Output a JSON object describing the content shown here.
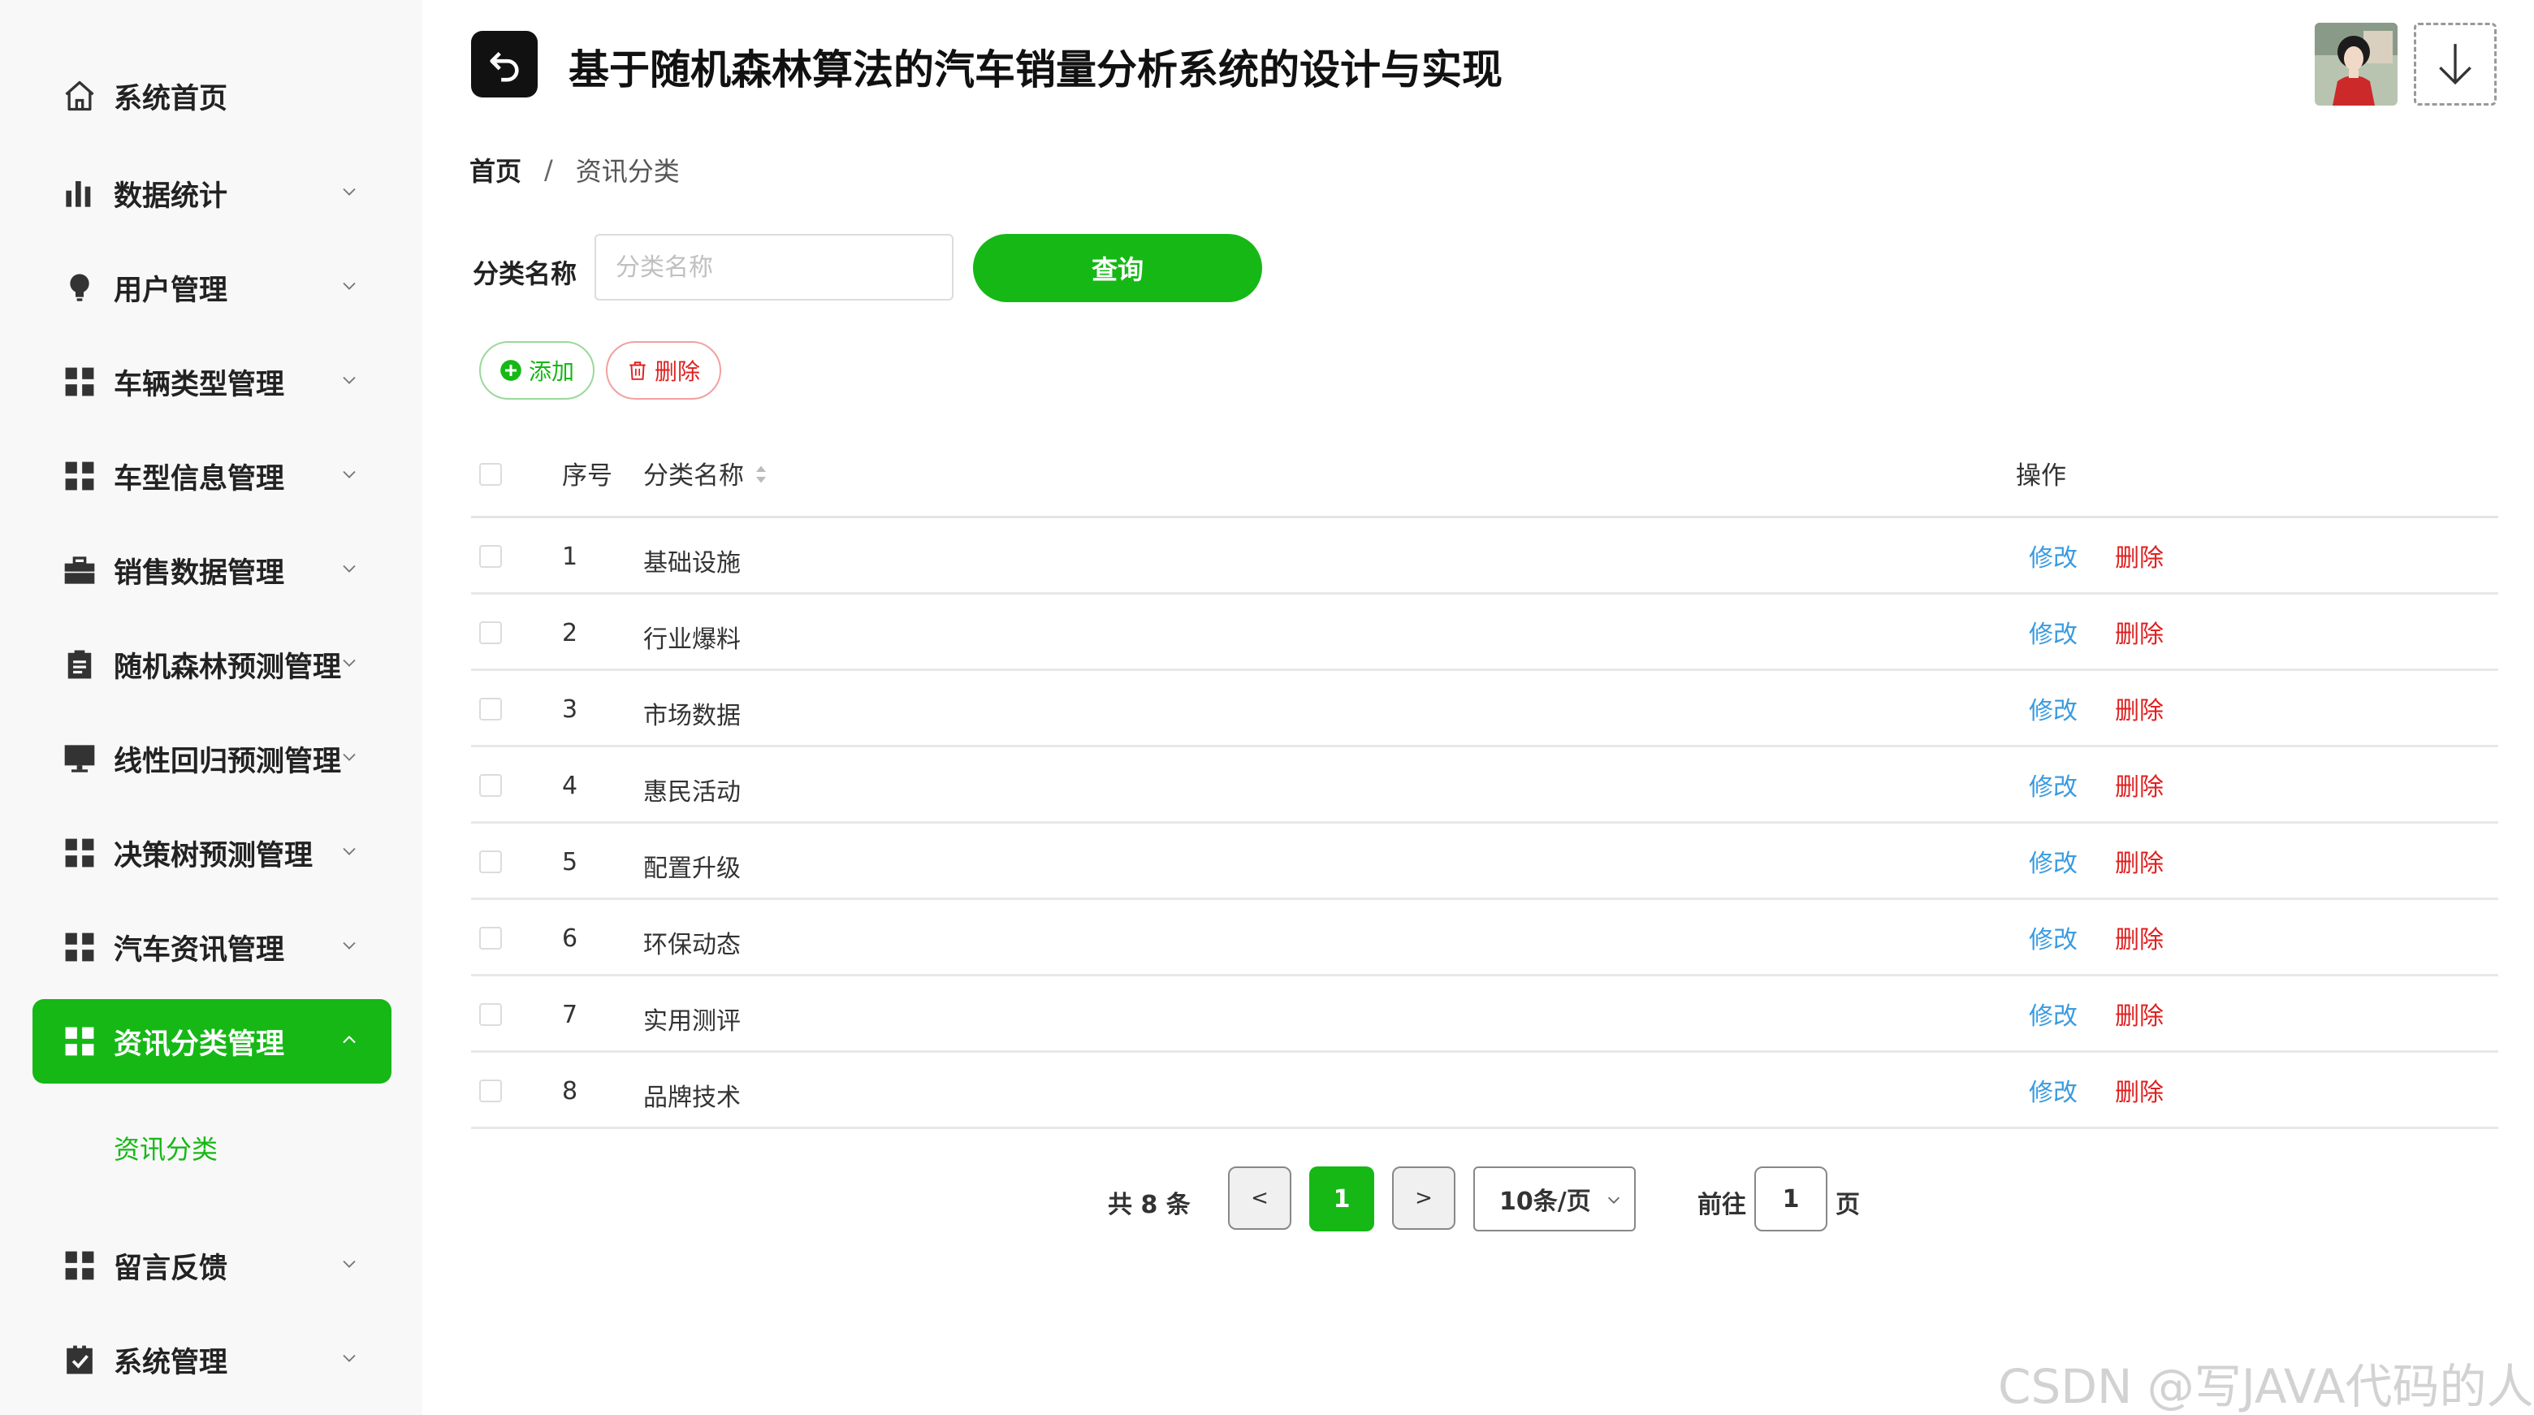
{
  "header": {
    "title": "基于随机森林算法的汽车销量分析系统的设计与实现"
  },
  "sidebar": {
    "items": [
      {
        "label": "系统首页",
        "icon": "home-icon",
        "has_chevron": false
      },
      {
        "label": "数据统计",
        "icon": "bar-chart-icon",
        "has_chevron": true
      },
      {
        "label": "用户管理",
        "icon": "lightbulb-icon",
        "has_chevron": true
      },
      {
        "label": "车辆类型管理",
        "icon": "grid-icon",
        "has_chevron": true
      },
      {
        "label": "车型信息管理",
        "icon": "grid-icon",
        "has_chevron": true
      },
      {
        "label": "销售数据管理",
        "icon": "briefcase-icon",
        "has_chevron": true
      },
      {
        "label": "随机森林预测管理",
        "icon": "clipboard-icon",
        "has_chevron": true
      },
      {
        "label": "线性回归预测管理",
        "icon": "monitor-icon",
        "has_chevron": true
      },
      {
        "label": "决策树预测管理",
        "icon": "grid-icon",
        "has_chevron": true
      },
      {
        "label": "汽车资讯管理",
        "icon": "grid-icon",
        "has_chevron": true
      },
      {
        "label": "资讯分类管理",
        "icon": "grid-icon",
        "has_chevron": true,
        "active": true
      },
      {
        "label": "留言反馈",
        "icon": "grid-icon",
        "has_chevron": true
      },
      {
        "label": "系统管理",
        "icon": "checkbox-icon",
        "has_chevron": true
      }
    ],
    "submenu": {
      "label": "资讯分类"
    }
  },
  "breadcrumb": {
    "home": "首页",
    "separator": "/",
    "current": "资讯分类"
  },
  "search": {
    "label": "分类名称",
    "placeholder": "分类名称",
    "value": "",
    "button": "查询"
  },
  "actions": {
    "add": "添加",
    "delete": "删除"
  },
  "table": {
    "columns": {
      "index": "序号",
      "name": "分类名称",
      "ops": "操作"
    },
    "edit_label": "修改",
    "delete_label": "删除",
    "rows": [
      {
        "index": "1",
        "name": "基础设施"
      },
      {
        "index": "2",
        "name": "行业爆料"
      },
      {
        "index": "3",
        "name": "市场数据"
      },
      {
        "index": "4",
        "name": "惠民活动"
      },
      {
        "index": "5",
        "name": "配置升级"
      },
      {
        "index": "6",
        "name": "环保动态"
      },
      {
        "index": "7",
        "name": "实用测评"
      },
      {
        "index": "8",
        "name": "品牌技术"
      }
    ]
  },
  "pagination": {
    "total": "共 8 条",
    "prev": "<",
    "current": "1",
    "next": ">",
    "page_size": "10条/页",
    "goto_label": "前往",
    "goto_value": "1",
    "page_unit": "页"
  },
  "watermark": "CSDN @写JAVA代码的人",
  "colors": {
    "accent": "#16b816",
    "danger": "#e02020",
    "link": "#3a9be0"
  }
}
